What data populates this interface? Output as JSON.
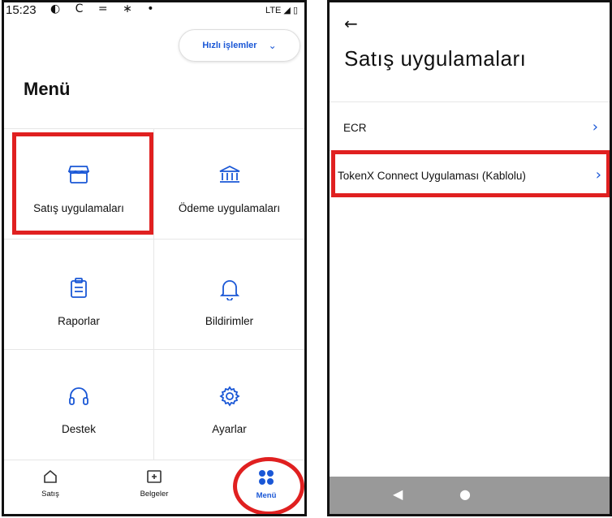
{
  "left": {
    "status": {
      "time": "15:23",
      "icons": "◐ C = ∗ •",
      "network": "LTE ◢ ▯"
    },
    "quick_actions": {
      "label": "Hızlı işlemler",
      "chevron": "⌄"
    },
    "title": "Menü",
    "grid": [
      {
        "label": "Satış uygulamaları",
        "icon": "store-icon"
      },
      {
        "label": "Ödeme uygulamaları",
        "icon": "bank-icon"
      },
      {
        "label": "Raporlar",
        "icon": "clipboard-icon"
      },
      {
        "label": "Bildirimler",
        "icon": "bell-icon"
      },
      {
        "label": "Destek",
        "icon": "headset-icon"
      },
      {
        "label": "Ayarlar",
        "icon": "gear-icon"
      }
    ],
    "bottom_nav": [
      {
        "label": "Satış",
        "icon": "home-icon"
      },
      {
        "label": "Belgeler",
        "icon": "document-plus-icon"
      },
      {
        "label": "Menü",
        "icon": "menu-dots-icon",
        "active": true
      }
    ]
  },
  "right": {
    "back": "←",
    "title": "Satış uygulamaları",
    "items": [
      {
        "label": "ECR"
      },
      {
        "label": "TokenX Connect Uygulaması (Kablolu)"
      }
    ],
    "arrow": "›",
    "sysnav": {
      "back": "◀",
      "home": "●"
    }
  },
  "colors": {
    "accent": "#1a57d6",
    "highlight": "#e02020"
  }
}
